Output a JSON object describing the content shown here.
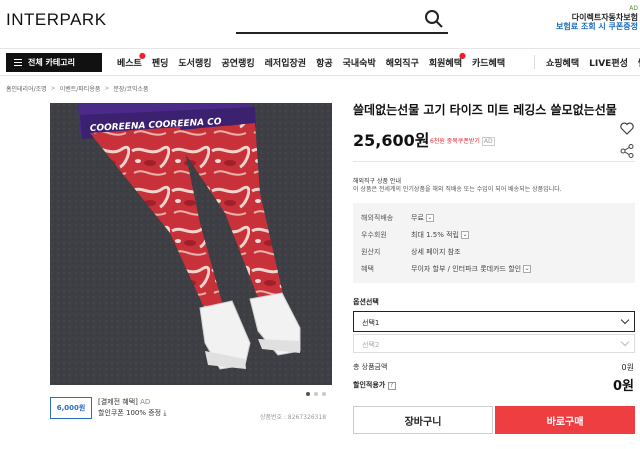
{
  "header": {
    "logo_text": "INTERPARK",
    "ad_banner": {
      "tag": "AD",
      "line1": "다이렉트자동차보험",
      "line2": "보험료 조회 시 쿠폰증정"
    }
  },
  "nav": {
    "category_button": "전체 카테고리",
    "items": [
      "베스트",
      "펜딩",
      "도서랭킹",
      "공연랭킹",
      "레저입장권",
      "항공",
      "국내숙박",
      "해외직구",
      "회원혜택",
      "카드혜택"
    ],
    "right_items": [
      "쇼핑혜택",
      "LIVE편성",
      "쎌"
    ]
  },
  "breadcrumb": [
    "홈인테리어/조명",
    "이벤트/파티용품",
    "분장/코믹소품"
  ],
  "product": {
    "title": "쓸데없는선물 고기 타이즈 미트 레깅스 쓸모없는선물",
    "price": "25,600원",
    "coupon_note": "6천원 중복쿠폰받기",
    "coupon_note_ad": "AD",
    "overseas_title": "해외직구 상품 안내",
    "overseas_desc": "이 상품은 전세계의 인기상품을 해외 직배송 또는 수입이 되어 배송되는 상품입니다.",
    "info": [
      {
        "key": "해외직배송",
        "value": "무료"
      },
      {
        "key": "우수회원",
        "value": "최대 1.5% 적립"
      },
      {
        "key": "원산지",
        "value": "상세 페이지 참조"
      },
      {
        "key": "혜택",
        "value": "무이자 할부 / 인터파크 롯데카드 할인"
      }
    ],
    "waistband_text": "COOREENA COOREENA CO",
    "product_number": "상품번호 : 8267326318"
  },
  "coupon": {
    "box_value": "6,000원",
    "line1": "[결제전 혜택]",
    "line1_ad": "AD",
    "line2": "할인쿠폰 100% 증정"
  },
  "options": {
    "title": "옵션선택",
    "select1": "선택1",
    "select2": "선택2"
  },
  "summary": {
    "total_label": "총 상품금액",
    "total_value": "0원",
    "discount_label": "할인적용가",
    "discount_help": "?",
    "discount_value": "0원"
  },
  "buttons": {
    "cart": "장바구니",
    "buy": "바로구매"
  },
  "pager": {
    "count": 3,
    "active": 0
  },
  "colors": {
    "accent": "#ef3e42",
    "coupon_blue": "#2b6ec5"
  }
}
